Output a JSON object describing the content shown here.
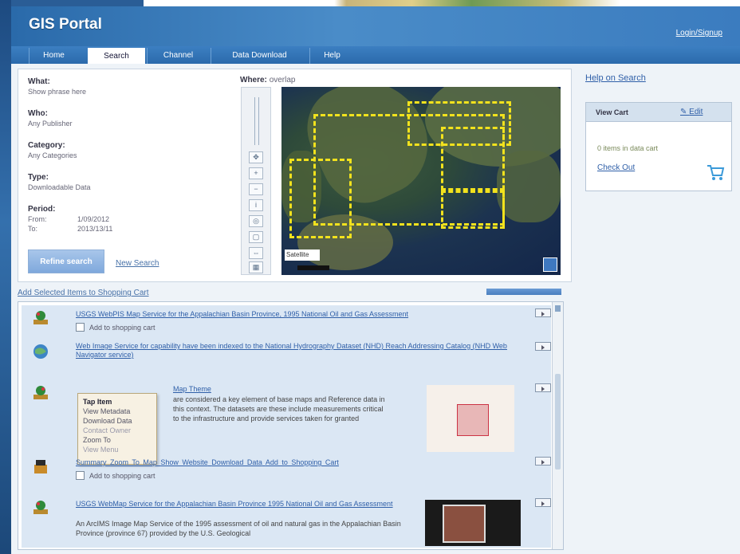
{
  "app": {
    "title": "GIS Portal",
    "login_link": "Login/Signup"
  },
  "tabs": [
    {
      "label": "Home"
    },
    {
      "label": "Search"
    },
    {
      "label": "Channel"
    },
    {
      "label": "Data Download"
    },
    {
      "label": "Help"
    }
  ],
  "filters": {
    "what_label": "What:",
    "what_value": "Show phrase here",
    "who_label": "Who:",
    "who_value": "Any Publisher",
    "category_label": "Category:",
    "category_value": "Any Categories",
    "type_label": "Type:",
    "type_value": "Downloadable Data",
    "period_label": "Period:",
    "from_label": "From:",
    "from_value": "1/09/2012",
    "to_label": "To:",
    "to_value": "2013/13/11",
    "refine_button": "Refine search",
    "new_search_link": "New Search"
  },
  "map": {
    "where_label": "Where:",
    "where_value": "overlap",
    "legend_text": "Satellite"
  },
  "results": {
    "add_selected_link": "Add Selected Items to Shopping Cart",
    "items": [
      {
        "title": "USGS WebPIS Map Service for the Appalachian Basin Province, 1995 National Oil and Gas Assessment",
        "checkbox_label": "Add to shopping cart"
      },
      {
        "title": "Web Image Service for capability have been indexed to the National Hydrography Dataset (NHD) Reach Addressing Catalog (NHD Web Navigator service)"
      },
      {
        "title_fragment": "Map Theme",
        "description": "are considered a key element of base maps and Reference data in this context. The datasets are these include measurements critical to the infrastructure and provide services taken for granted",
        "links": [
          "Summary",
          "Zoom To Map",
          "Show Website",
          "Download Data",
          "Add to Shopping Cart"
        ],
        "checkbox_label": "Add to shopping cart"
      },
      {
        "title": "USGS WebMap Service for the Appalachian Basin Province 1995 National Oil and Gas Assessment",
        "description": "An ArcIMS Image Map Service of the 1995 assessment of oil and natural gas in the Appalachian Basin Province (province 67) provided by the U.S. Geological"
      }
    ],
    "context_menu": {
      "items": [
        "Tap Item",
        "View Metadata",
        "Download Data",
        "Contact Owner",
        "Zoom To",
        "View Menu"
      ]
    }
  },
  "sidebar": {
    "help_link": "Help on Search",
    "cart": {
      "title": "View Cart",
      "edit_link": "Edit",
      "count_text": "0 items in data cart",
      "checkout_link": "Check Out"
    }
  }
}
